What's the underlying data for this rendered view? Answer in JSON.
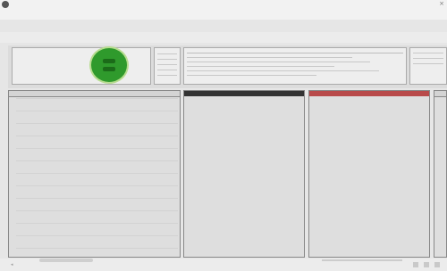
{
  "window": {
    "close_glyph": "×"
  },
  "menu": {
    "items": [
      "",
      "",
      "",
      "",
      "",
      "",
      "",
      "",
      "",
      "",
      "",
      "",
      ""
    ]
  },
  "ribbon": {
    "tabs": [
      "",
      "",
      "",
      "",
      "",
      "",
      "",
      ""
    ]
  },
  "info_panel": {
    "label": ""
  },
  "status_indicator": {
    "state": "ok",
    "color": "#2f9a2c"
  },
  "columns": [
    {
      "id": "col1",
      "header": "",
      "accent": "#888888"
    },
    {
      "id": "col2",
      "header": "",
      "accent": "#333333"
    },
    {
      "id": "col3",
      "header": "",
      "accent": "#b84a4a"
    },
    {
      "id": "col4",
      "header": "",
      "accent": "#888888"
    }
  ],
  "footer": {
    "nav_glyph": "◂"
  }
}
